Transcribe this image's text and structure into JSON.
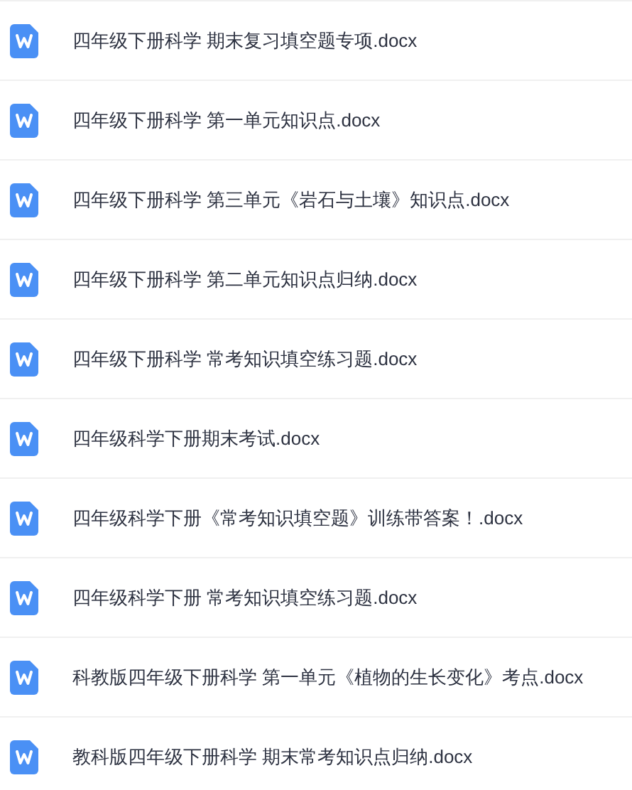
{
  "files": [
    {
      "name": "四年级下册科学 期末复习填空题专项.docx"
    },
    {
      "name": "四年级下册科学 第一单元知识点.docx"
    },
    {
      "name": "四年级下册科学 第三单元《岩石与土壤》知识点.docx"
    },
    {
      "name": "四年级下册科学 第二单元知识点归纳.docx"
    },
    {
      "name": "四年级下册科学 常考知识填空练习题.docx"
    },
    {
      "name": "四年级科学下册期末考试.docx"
    },
    {
      "name": "四年级科学下册《常考知识填空题》训练带答案！.docx"
    },
    {
      "name": "四年级科学下册 常考知识填空练习题.docx"
    },
    {
      "name": "科教版四年级下册科学 第一单元《植物的生长变化》考点.docx"
    },
    {
      "name": "教科版四年级下册科学 期末常考知识点归纳.docx"
    }
  ]
}
